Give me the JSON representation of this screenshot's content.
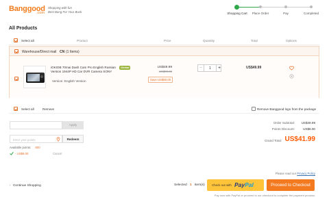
{
  "header": {
    "logo_text": "Banggood",
    "logo_com": ".com",
    "tagline1": "Shopping with fun",
    "tagline2": "Best Bang For Your Buck",
    "steps": [
      "Shopping Cart",
      "Place Order",
      "Pay",
      "Completed"
    ]
  },
  "page_title": "All Products",
  "columns": {
    "select_all": "Select all",
    "product": "Product",
    "price": "Price",
    "quantity": "Quantity",
    "total": "Total",
    "options": "Options"
  },
  "warehouse": {
    "name": "Warehouse/Direct mail",
    "code": "CN",
    "count": "(1 Items)"
  },
  "item": {
    "title": "iOKIOB 70mai Dash Cam Pro English Russian Version 1944P HD Car DVR Camera SONY",
    "badge": "Global",
    "variant": "Version: English Version",
    "price": "US$49.99",
    "old_price": "US$99.99",
    "save": "Save US$50.00",
    "quantity": "1",
    "total": "US$49.99"
  },
  "bottom_bar": {
    "select_all": "Select all",
    "remove": "Remove",
    "remove_logo": "Remove Banggood logo from the package"
  },
  "coupon": {
    "placeholder": "",
    "apply": "Apply"
  },
  "points": {
    "placeholder": "Enter your points",
    "redeem": "Redeem",
    "available_label": "Available points:",
    "available_value": "800",
    "discount": "- US$8.00",
    "cancel": "Cancel"
  },
  "summary": {
    "subtotal_label": "Order Subtotal:",
    "subtotal_value": "US$49.99",
    "points_label": "Points Discount:",
    "points_value": "US$8.00",
    "grand_label": "Grand Total:",
    "grand_value": "US$41.99"
  },
  "footer": {
    "privacy_prefix": "Please read our",
    "privacy_link": "Privacy Policy",
    "continue": "Continue Shopping",
    "selected_prefix": "Selected",
    "selected_count": "1",
    "selected_suffix": "item(s)",
    "paypal_prefix": "Check out with",
    "paypal_pay": "Pay",
    "paypal_pal": "Pal",
    "checkout": "Proceed to Checkout",
    "note": "Pay now with PayPal or proceed to our checkout to complete the payment process."
  },
  "colors": {
    "accent": "#e8702a",
    "step_active": "#2ea84a",
    "paypal_yellow": "#ffc439",
    "paypal_dark": "#253b80",
    "paypal_light": "#179bd7",
    "grand_total": "#ff5a00"
  }
}
